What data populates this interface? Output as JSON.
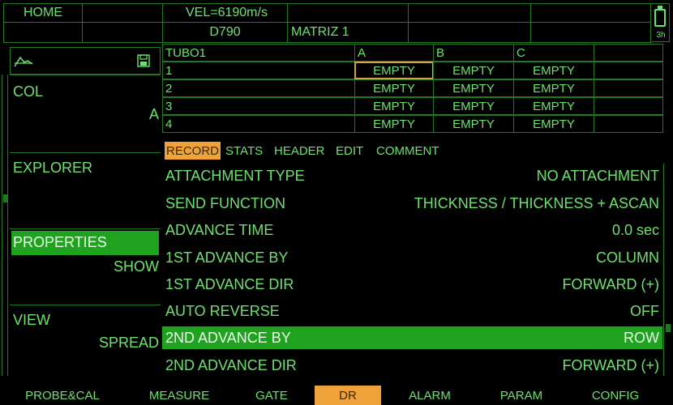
{
  "header": {
    "home": "HOME",
    "velocity": "VEL=6190m/s",
    "probe": "D790",
    "matrix": "MATRIZ 1",
    "battery_time": "3h"
  },
  "sidebar": {
    "icons": {
      "left": "waveform-icon",
      "right": "save-icon"
    },
    "panels": [
      {
        "title": "COL",
        "value": "A"
      },
      {
        "title": "EXPLORER",
        "value": ""
      },
      {
        "title": "PROPERTIES",
        "value": "SHOW"
      },
      {
        "title": "VIEW",
        "value": "SPREAD"
      }
    ]
  },
  "grid": {
    "name": "TUBO1",
    "columns": [
      "A",
      "B",
      "C"
    ],
    "rows": [
      {
        "label": "1",
        "cells": [
          "EMPTY",
          "EMPTY",
          "EMPTY"
        ]
      },
      {
        "label": "2",
        "cells": [
          "EMPTY",
          "EMPTY",
          "EMPTY"
        ]
      },
      {
        "label": "3",
        "cells": [
          "EMPTY",
          "EMPTY",
          "EMPTY"
        ]
      },
      {
        "label": "4",
        "cells": [
          "EMPTY",
          "EMPTY",
          "EMPTY"
        ]
      }
    ]
  },
  "tabs": [
    "RECORD",
    "STATS",
    "HEADER",
    "EDIT",
    "COMMENT"
  ],
  "properties": [
    {
      "label": "ATTACHMENT TYPE",
      "value": "NO ATTACHMENT"
    },
    {
      "label": "SEND FUNCTION",
      "value": "THICKNESS / THICKNESS + ASCAN"
    },
    {
      "label": "ADVANCE TIME",
      "value": "0.0 sec"
    },
    {
      "label": "1ST ADVANCE BY",
      "value": "COLUMN"
    },
    {
      "label": "1ST ADVANCE DIR",
      "value": "FORWARD (+)"
    },
    {
      "label": "AUTO REVERSE",
      "value": "OFF"
    },
    {
      "label": "2ND ADVANCE BY",
      "value": "ROW"
    },
    {
      "label": "2ND ADVANCE DIR",
      "value": "FORWARD (+)"
    }
  ],
  "bottom_nav": [
    "PROBE&CAL",
    "MEASURE",
    "GATE",
    "DR",
    "ALARM",
    "PARAM",
    "CONFIG"
  ],
  "colors": {
    "text_green": "#6ee06e",
    "border_green": "#1f7a1f",
    "highlight_green": "#1fa31f",
    "accent_orange": "#f0a23a",
    "selection_outline": "#d4a24a"
  }
}
